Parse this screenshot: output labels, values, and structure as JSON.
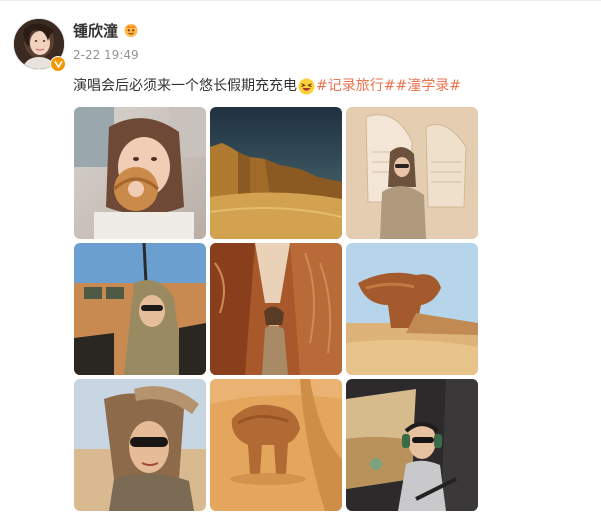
{
  "post": {
    "username": "锺欣潼",
    "timestamp": "2-22 19:49",
    "text_main": "演唱会后必须来一个悠长假期充充电",
    "emoji_name": "laughing-squint-emoji",
    "hashtags": [
      "#记录旅行#",
      "#潼学录#"
    ],
    "verified_badge": "verified-badge-icon",
    "member_icon": "vip-member-icon"
  },
  "colors": {
    "hashtag": "#eb7350",
    "username": "#333333",
    "timestamp": "#939393",
    "verified": "#f39800"
  },
  "photos": [
    {
      "name": "photo-woman-eating-bagel",
      "icon": "photo-thumbnail"
    },
    {
      "name": "photo-desert-rocks-night-sky",
      "icon": "photo-thumbnail"
    },
    {
      "name": "photo-woman-macrame-chair",
      "icon": "photo-thumbnail"
    },
    {
      "name": "photo-woman-hood-safari-jeep",
      "icon": "photo-thumbnail"
    },
    {
      "name": "photo-woman-red-rock-canyon",
      "icon": "photo-thumbnail"
    },
    {
      "name": "photo-rock-formation-desert",
      "icon": "photo-thumbnail"
    },
    {
      "name": "photo-woman-sunglasses-windblown",
      "icon": "photo-thumbnail"
    },
    {
      "name": "photo-elephant-rock-aerial",
      "icon": "photo-thumbnail"
    },
    {
      "name": "photo-woman-helicopter-headset",
      "icon": "photo-thumbnail"
    }
  ]
}
